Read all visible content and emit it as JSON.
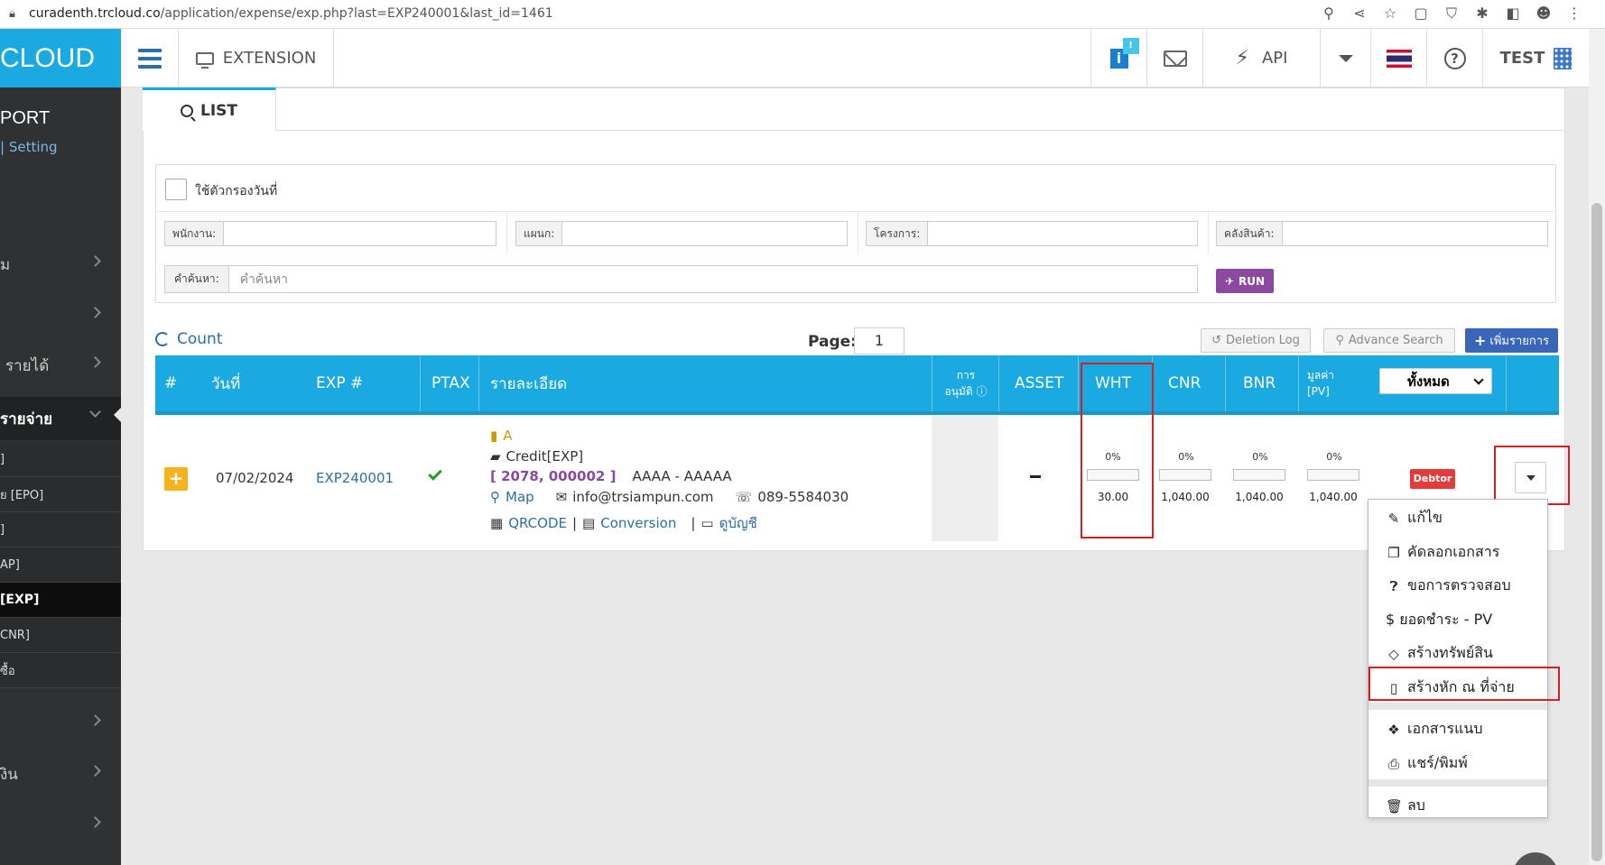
{
  "browser": {
    "url_host": "curadenth.trcloud.co",
    "url_path": "/application/expense/exp.php?last=EXP240001&last_id=1461"
  },
  "header": {
    "brand": "CLOUD",
    "extension_label": "EXTENSION",
    "info_badge": "!",
    "api_label": "API",
    "user_label": "TEST"
  },
  "sidebar": {
    "title": "PORT",
    "setting_label": "| Setting",
    "rows": [
      {
        "label": "ม"
      },
      {
        "label": ""
      },
      {
        "label": "รายได้"
      },
      {
        "label": "รายจ่าย"
      }
    ],
    "subitems": [
      {
        "label": "]"
      },
      {
        "label": "ย [EPO]"
      },
      {
        "label": "]"
      },
      {
        "label": "AP]"
      },
      {
        "label": "[EXP]"
      },
      {
        "label": "CNR]"
      },
      {
        "label": "ซื้อ"
      }
    ],
    "rows_bottom": [
      {
        "label": ""
      },
      {
        "label": "งิน"
      },
      {
        "label": ""
      }
    ]
  },
  "tabs": {
    "list_label": "LIST"
  },
  "filters": {
    "date_filter_label": "ใช้ตัวกรองวันที่",
    "employee_label": "พนักงาน:",
    "department_label": "แผนก:",
    "project_label": "โครงการ:",
    "warehouse_label": "คลังสินค้า:",
    "search_label": "คำค้นหา:",
    "search_placeholder": "คำค้นหา",
    "run_label": "RUN"
  },
  "toolbar": {
    "count_label": "Count",
    "page_label": "Page:",
    "page_value": "1",
    "deletion_log_label": "Deletion Log",
    "advance_search_label": "Advance Search",
    "add_label": "เพิ่มรายการ"
  },
  "table": {
    "headers": {
      "num": "#",
      "date": "วันที่",
      "exp": "EXP #",
      "ptax": "PTAX",
      "detail": "รายละเอียด",
      "approve_1": "การ",
      "approve_2": "อนุมัติ",
      "asset": "ASSET",
      "wht": "WHT",
      "cnr": "CNR",
      "bnr": "BNR",
      "pv_1": "มูลค่า",
      "pv_2": "[PV]",
      "filter_select": "ทั้งหมด"
    },
    "row": {
      "date": "07/02/2024",
      "exp_no": "EXP240001",
      "detail_a": "A",
      "detail_credit": "Credit[EXP]",
      "detail_code": "[ 2078, 000002 ]",
      "detail_name": "AAAA - AAAAA",
      "map_label": "Map",
      "email": "info@trsiampun.com",
      "phone": "089-5584030",
      "qrcode_label": "QRCODE",
      "conversion_label": "Conversion",
      "account_label": "ดูบัญชี",
      "asset_value": "−",
      "wht_pct": "0%",
      "wht_amount": "30.00",
      "cnr_pct": "0%",
      "cnr_amount": "1,040.00",
      "bnr_pct": "0%",
      "bnr_amount": "1,040.00",
      "pv_pct": "0%",
      "pv_amount": "1,040.00",
      "status_badge": "Debtor",
      "progress": {
        "wht": 0,
        "cnr": 0,
        "bnr": 0,
        "pv": 0
      }
    }
  },
  "menu": {
    "items": [
      {
        "label": "แก้ไข",
        "icon": "edit-icon"
      },
      {
        "label": "คัดลอกเอกสาร",
        "icon": "copy-icon"
      },
      {
        "label": "ขอการตรวจสอบ",
        "icon": "question-icon"
      },
      {
        "label": "$ ยอดชำระ - PV",
        "icon": "dollar-icon"
      },
      {
        "label": "สร้างทรัพย์สิน",
        "icon": "diamond-icon"
      },
      {
        "label": "สร้างหัก ณ ที่จ่าย",
        "icon": "word-file-icon"
      },
      {
        "label": "เอกสารแนบ",
        "icon": "dropbox-icon"
      },
      {
        "label": "แชร์/พิมพ์",
        "icon": "print-icon"
      },
      {
        "label": "ลบ",
        "icon": "trash-icon"
      }
    ]
  },
  "colors": {
    "primary": "#1aa9e0",
    "sidebar": "#2f3132",
    "highlight": "#d42020",
    "run": "#8b4aa0",
    "add": "#3a66b9",
    "debtor": "#e23b3b"
  }
}
